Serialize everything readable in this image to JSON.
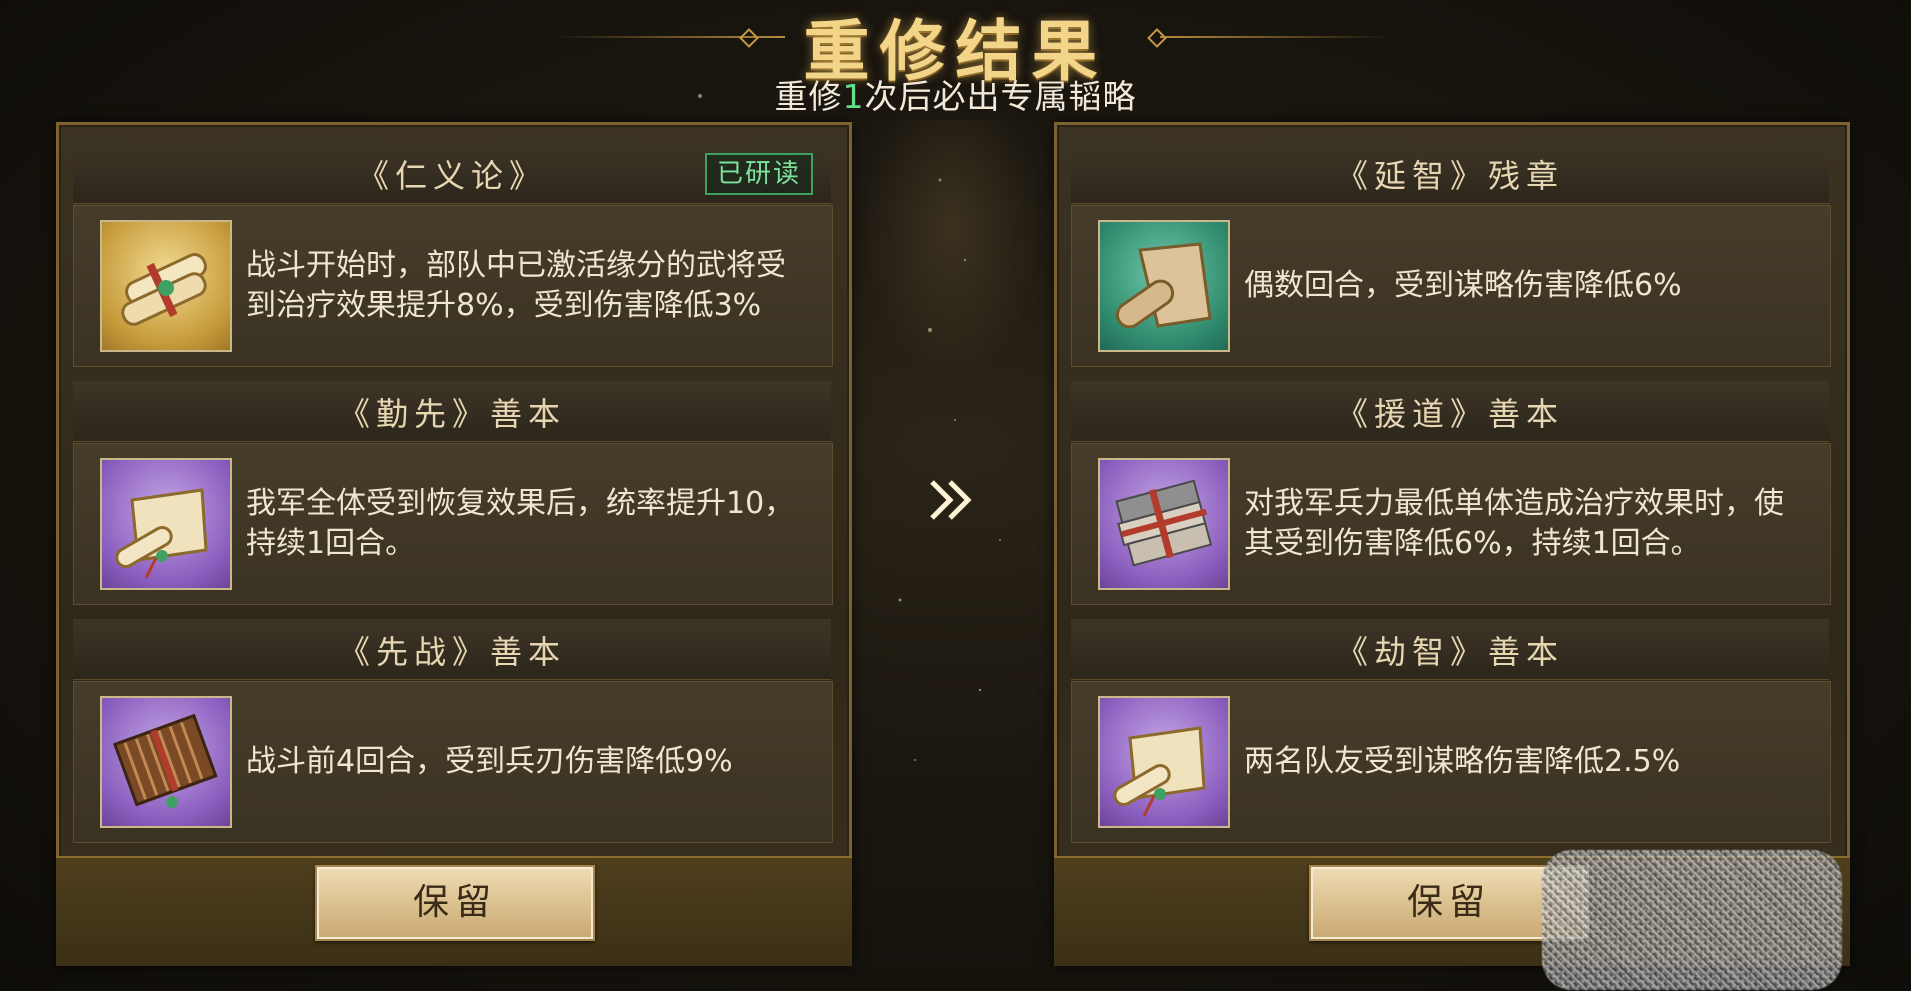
{
  "header": {
    "title": "重修结果",
    "subtitle_pre": "重修",
    "subtitle_num": "1",
    "subtitle_post": "次后必出专属韬略"
  },
  "left": {
    "cards": [
      {
        "title": "《仁义论》",
        "badge": "已研读",
        "desc": "战斗开始时，部队中已激活缘分的武将受到治疗效果提升8%，受到伤害降低3%",
        "icon": "scroll-bundle-icon",
        "rarity": "gold"
      },
      {
        "title": "《勤先》善本",
        "desc": "我军全体受到恢复效果后，统率提升10，持续1回合。",
        "icon": "scroll-icon",
        "rarity": "purple"
      },
      {
        "title": "《先战》善本",
        "desc": "战斗前4回合，受到兵刃伤害降低9%",
        "icon": "bamboo-book-icon",
        "rarity": "purple"
      }
    ],
    "keep_label": "保留"
  },
  "right": {
    "cards": [
      {
        "title": "《延智》残章",
        "desc": "偶数回合，受到谋略伤害降低6%",
        "icon": "torn-scroll-icon",
        "rarity": "teal"
      },
      {
        "title": "《援道》善本",
        "desc": "对我军兵力最低单体造成治疗效果时，使其受到伤害降低6%，持续1回合。",
        "icon": "tied-books-icon",
        "rarity": "purple"
      },
      {
        "title": "《劫智》善本",
        "desc": "两名队友受到谋略伤害降低2.5%",
        "icon": "scroll-icon",
        "rarity": "purple"
      }
    ],
    "keep_label": "保留"
  },
  "center": {
    "arrow_icon": "double-chevron-right-icon"
  },
  "colors": {
    "gold_title": "#f3d58a",
    "green_highlight": "#5fe08a",
    "panel_border": "#7a6331",
    "button_bg": "#d9bf8c"
  }
}
